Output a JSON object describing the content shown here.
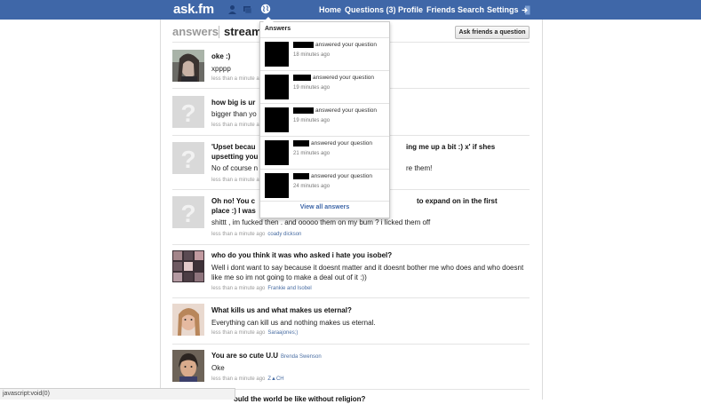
{
  "topbar": {
    "logo": "ask.fm",
    "nav": [
      "Home",
      "Questions (3)",
      "Profile",
      "Friends",
      "Search",
      "Settings"
    ],
    "bg_color": "#3f67a8"
  },
  "tabs": {
    "answers": "answers",
    "stream": "stream"
  },
  "ask_button": "Ask friends a question",
  "feed": [
    {
      "question": "oke :)",
      "answer": "xpppp",
      "time": "less than a minute ago",
      "user": ""
    },
    {
      "question": "how big is ur",
      "answer": "bigger than yo",
      "time": "less than a minute ago",
      "user": ""
    },
    {
      "question": "'Upset becau",
      "question_tail": "ing me up a bit :) x' if shes",
      "question_line2": "upsetting you",
      "answer": "No of course n",
      "answer_tail": "re them!",
      "time": "less than a minute ago",
      "user": ""
    },
    {
      "question": "Oh no! You c",
      "question_tail": "to expand on in the first",
      "question_line2": "place :) I was",
      "answer": "shittt , im fucked then . and ooooo them on my bum ? i licked them off",
      "time": "less than a minute ago",
      "user": "coady dickson"
    },
    {
      "question": "who do you think it was who asked i hate you isobel?",
      "answer": "Well i dont want to say because it doesnt matter and it doesnt bother me who does and who doesnt like me so im not going to make a deal out of it :))",
      "time": "less than a minute ago",
      "user": "Frankie and Isobel"
    },
    {
      "question": "What kills us and what makes us eternal?",
      "answer": "Everything can kill us and nothing makes us eternal.",
      "time": "less than a minute ago",
      "user": "Saraajones;)"
    },
    {
      "question": "You are so cute U.U",
      "asked_by": "Brenda Swenson",
      "answer": "Oke",
      "time": "less than a minute ago",
      "user": "Z▲CH"
    },
    {
      "question": "ould the world be like without religion?"
    }
  ],
  "dropdown": {
    "title": "Answers",
    "items": [
      {
        "text": "answered your question",
        "time": "18 minutes ago"
      },
      {
        "text": "answered your question",
        "time": "19 minutes ago"
      },
      {
        "text": "answered your question",
        "time": "19 minutes ago"
      },
      {
        "text": "answered your question",
        "time": "21 minutes ago"
      },
      {
        "text": "answered your question",
        "time": "24 minutes ago"
      }
    ],
    "view_all": "View all answers"
  },
  "statusbar": "javascript:void(0)"
}
